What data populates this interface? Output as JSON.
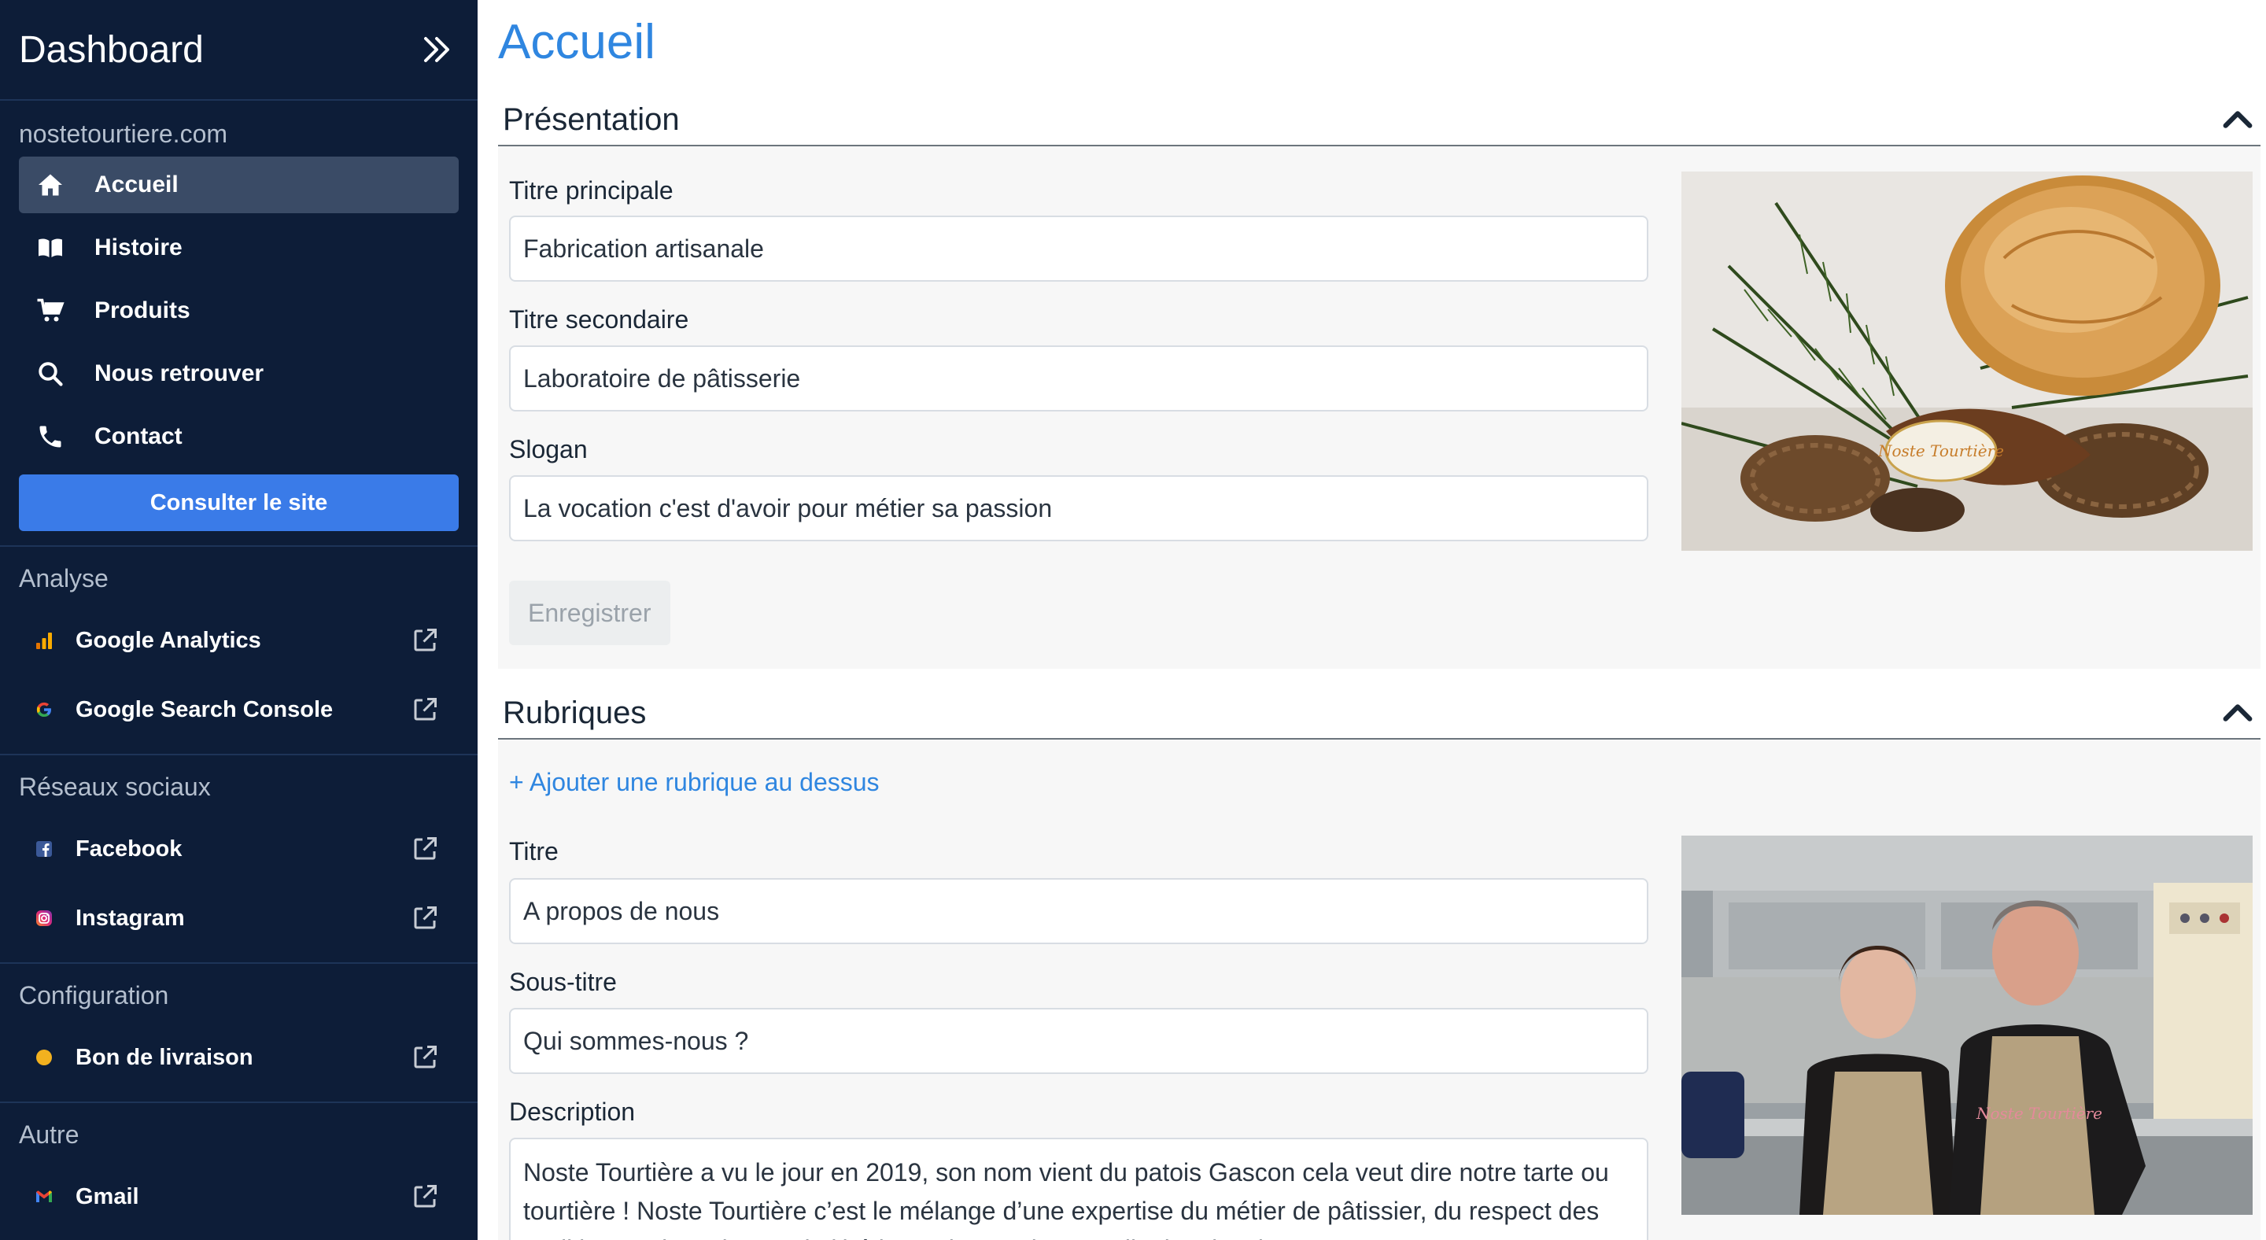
{
  "sidebar": {
    "brand": "Dashboard",
    "site_name": "nostetourtiere.com",
    "nav": [
      {
        "label": "Accueil",
        "icon": "home-icon",
        "active": true
      },
      {
        "label": "Histoire",
        "icon": "book-icon"
      },
      {
        "label": "Produits",
        "icon": "cart-icon"
      },
      {
        "label": "Nous retrouver",
        "icon": "search-icon"
      },
      {
        "label": "Contact",
        "icon": "phone-icon"
      }
    ],
    "site_button": "Consulter le site",
    "sections": [
      {
        "title": "Analyse",
        "items": [
          {
            "label": "Google Analytics",
            "icon": "google-analytics-icon"
          },
          {
            "label": "Google Search Console",
            "icon": "google-icon"
          }
        ]
      },
      {
        "title": "Réseaux sociaux",
        "items": [
          {
            "label": "Facebook",
            "icon": "facebook-icon"
          },
          {
            "label": "Instagram",
            "icon": "instagram-icon"
          }
        ]
      },
      {
        "title": "Configuration",
        "items": [
          {
            "label": "Bon de livraison",
            "icon": "dot-icon"
          }
        ]
      },
      {
        "title": "Autre",
        "items": [
          {
            "label": "Gmail",
            "icon": "gmail-icon"
          }
        ]
      }
    ]
  },
  "main": {
    "title": "Accueil",
    "presentation": {
      "heading": "Présentation",
      "fields": [
        {
          "label": "Titre principale",
          "value": "Fabrication artisanale"
        },
        {
          "label": "Titre secondaire",
          "value": "Laboratoire de pâtisserie"
        },
        {
          "label": "Slogan",
          "value": "La vocation c'est d'avoir pour métier sa passion"
        }
      ],
      "save_label": "Enregistrer",
      "image_text": "Noste Tourtière"
    },
    "rubriques": {
      "heading": "Rubriques",
      "add_link": "+ Ajouter une rubrique au dessus",
      "fields": [
        {
          "label": "Titre",
          "value": "A propos de nous"
        },
        {
          "label": "Sous-titre",
          "value": "Qui sommes-nous ?"
        }
      ],
      "description_label": "Description",
      "description": "Noste Tourtière a vu le jour en 2019, son nom vient du patois Gascon cela veut dire notre tarte ou tourtière ! Noste Tourtière c’est le mélange d’une expertise du métier de pâtissier, du respect des traditions artisanales, et de l’héritage des pratiques culinaires locales.",
      "image_text": "Noste Tourtière"
    }
  },
  "colors": {
    "sidebar_bg": "#0d1d38",
    "accent": "#3a7be8",
    "title_blue": "#2f86e0"
  }
}
